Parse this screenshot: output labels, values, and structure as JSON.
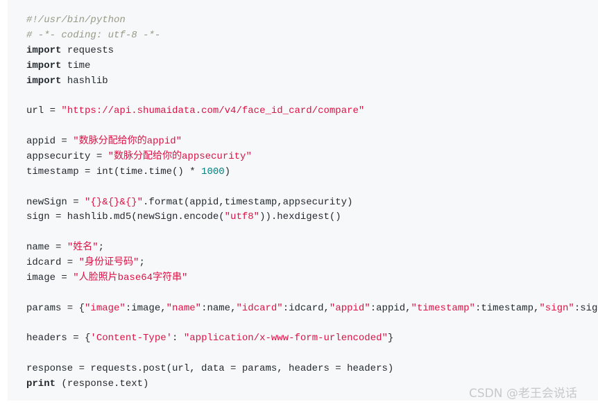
{
  "colors": {
    "background": "#f6f8fa",
    "text": "#24292e",
    "string": "#dd1144",
    "comment": "#999988",
    "number": "#008080"
  },
  "code_lines": [
    [
      [
        "comment",
        "#!/usr/bin/python"
      ]
    ],
    [
      [
        "comment",
        "# -*- coding: utf-8 -*-"
      ]
    ],
    [
      [
        "kw",
        "import"
      ],
      [
        "plain",
        " requests"
      ]
    ],
    [
      [
        "kw",
        "import"
      ],
      [
        "plain",
        " time"
      ]
    ],
    [
      [
        "kw",
        "import"
      ],
      [
        "plain",
        " hashlib"
      ]
    ],
    [],
    [
      [
        "plain",
        "url = "
      ],
      [
        "str",
        "\"https://api.shumaidata.com/v4/face_id_card/compare\""
      ]
    ],
    [],
    [
      [
        "plain",
        "appid = "
      ],
      [
        "str",
        "\"数脉分配给你的appid\""
      ]
    ],
    [
      [
        "plain",
        "appsecurity = "
      ],
      [
        "str",
        "\"数脉分配给你的appsecurity\""
      ]
    ],
    [
      [
        "plain",
        "timestamp = int(time.time() * "
      ],
      [
        "num",
        "1000"
      ],
      [
        "plain",
        ")"
      ]
    ],
    [],
    [
      [
        "plain",
        "newSign = "
      ],
      [
        "str",
        "\"{}&{}&{}\""
      ],
      [
        "plain",
        ".format(appid,timestamp,appsecurity)"
      ]
    ],
    [
      [
        "plain",
        "sign = hashlib.md5(newSign.encode("
      ],
      [
        "str",
        "\"utf8\""
      ],
      [
        "plain",
        ")).hexdigest()"
      ]
    ],
    [],
    [
      [
        "plain",
        "name = "
      ],
      [
        "str",
        "\"姓名\""
      ],
      [
        "plain",
        ";"
      ]
    ],
    [
      [
        "plain",
        "idcard = "
      ],
      [
        "str",
        "\"身份证号码\""
      ],
      [
        "plain",
        ";"
      ]
    ],
    [
      [
        "plain",
        "image = "
      ],
      [
        "str",
        "\"人脸照片base64字符串\""
      ]
    ],
    [],
    [
      [
        "plain",
        "params = {"
      ],
      [
        "str",
        "\"image\""
      ],
      [
        "plain",
        ":image,"
      ],
      [
        "str",
        "\"name\""
      ],
      [
        "plain",
        ":name,"
      ],
      [
        "str",
        "\"idcard\""
      ],
      [
        "plain",
        ":idcard,"
      ],
      [
        "str",
        "\"appid\""
      ],
      [
        "plain",
        ":appid,"
      ],
      [
        "str",
        "\"timestamp\""
      ],
      [
        "plain",
        ":timestamp,"
      ],
      [
        "str",
        "\"sign\""
      ],
      [
        "plain",
        ":sign}"
      ]
    ],
    [],
    [
      [
        "plain",
        "headers = {"
      ],
      [
        "str",
        "'Content-Type'"
      ],
      [
        "plain",
        ": "
      ],
      [
        "str",
        "\"application/x-www-form-urlencoded\""
      ],
      [
        "plain",
        "}"
      ]
    ],
    [],
    [
      [
        "plain",
        "response = requests.post(url, data = params, headers = headers)"
      ]
    ],
    [
      [
        "kw",
        "print"
      ],
      [
        "plain",
        " (response.text)"
      ]
    ]
  ],
  "watermark": "CSDN @老王会说话"
}
